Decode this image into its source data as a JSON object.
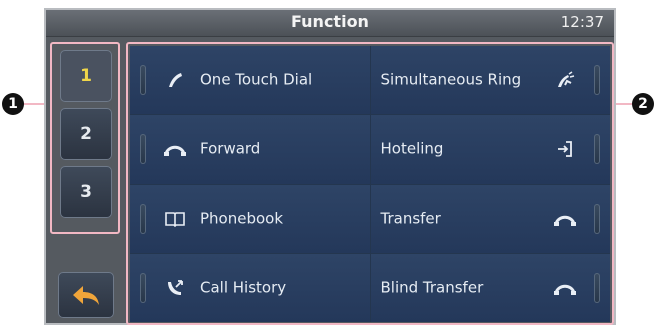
{
  "header": {
    "title": "Function",
    "time": "12:37"
  },
  "pages": [
    {
      "label": "1",
      "active": true
    },
    {
      "label": "2",
      "active": false
    },
    {
      "label": "3",
      "active": false
    }
  ],
  "functions": [
    {
      "label": "One Touch Dial",
      "icon": "handset-icon"
    },
    {
      "label": "Simultaneous Ring",
      "icon": "multi-handset-icon"
    },
    {
      "label": "Forward",
      "icon": "forward-handset-icon"
    },
    {
      "label": "Hoteling",
      "icon": "login-icon"
    },
    {
      "label": "Phonebook",
      "icon": "book-icon"
    },
    {
      "label": "Transfer",
      "icon": "transfer-handset-icon"
    },
    {
      "label": "Call History",
      "icon": "call-history-icon"
    },
    {
      "label": "Blind Transfer",
      "icon": "transfer-handset-icon"
    }
  ],
  "callouts": {
    "left": "1",
    "right": "2"
  },
  "colors": {
    "active_page": "#f0d64a",
    "back_arrow": "#f0a53a",
    "callout_frame": "#f2b8c4"
  }
}
